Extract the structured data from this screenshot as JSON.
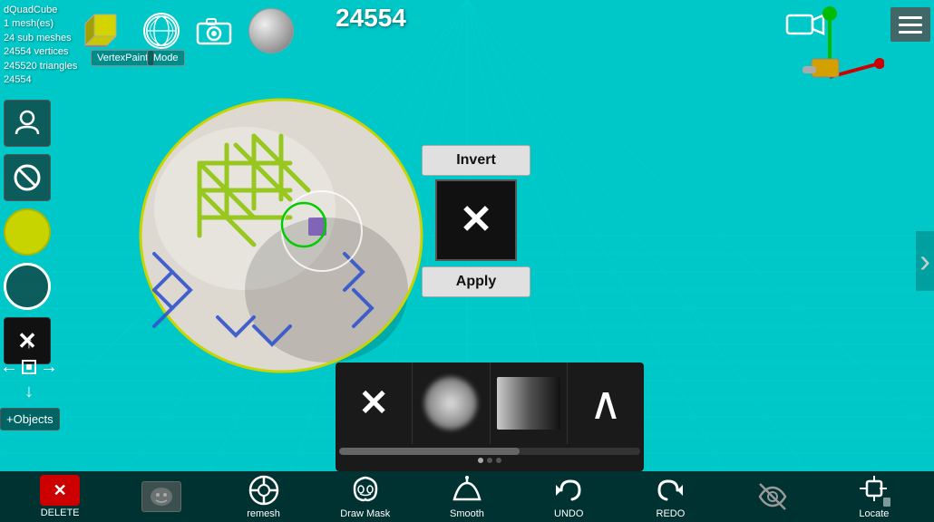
{
  "app": {
    "name": "dQuadCube",
    "mesh_count": "1 mesh(es)",
    "sub_meshes": "24 sub meshes",
    "vertices": "24554 vertices",
    "triangles": "245520 triangles",
    "id": "24554"
  },
  "header": {
    "vertex_count": "24554",
    "vertex_paint_label": "VertexPaint",
    "mode_label": "Mode"
  },
  "invert_panel": {
    "invert_label": "Invert",
    "apply_label": "Apply"
  },
  "brush_panel": {
    "brushes": [
      {
        "name": "x-brush",
        "icon": "✕"
      },
      {
        "name": "cloud-brush",
        "icon": "cloud"
      },
      {
        "name": "gradient-brush",
        "icon": "gradient"
      },
      {
        "name": "chevron-brush",
        "icon": "chevron"
      }
    ]
  },
  "bottom_toolbar": {
    "items": [
      {
        "name": "delete",
        "label": "DELETE",
        "icon": "✕"
      },
      {
        "name": "remesh",
        "label": "remesh",
        "icon": "⊕"
      },
      {
        "name": "draw-mask",
        "label": "Draw Mask",
        "icon": "🎭"
      },
      {
        "name": "smooth",
        "label": "Smooth",
        "icon": "~"
      },
      {
        "name": "undo",
        "label": "UNDO",
        "icon": "↩"
      },
      {
        "name": "redo",
        "label": "REDO",
        "icon": "↪"
      },
      {
        "name": "hide",
        "label": "",
        "icon": "👁"
      },
      {
        "name": "locate",
        "label": "Locate",
        "icon": "📍"
      }
    ]
  },
  "icons": {
    "hamburger": "menu-icon",
    "video_camera": "video-camera-icon",
    "camera": "camera-icon",
    "globe": "globe-icon",
    "chevron_right": "›"
  }
}
